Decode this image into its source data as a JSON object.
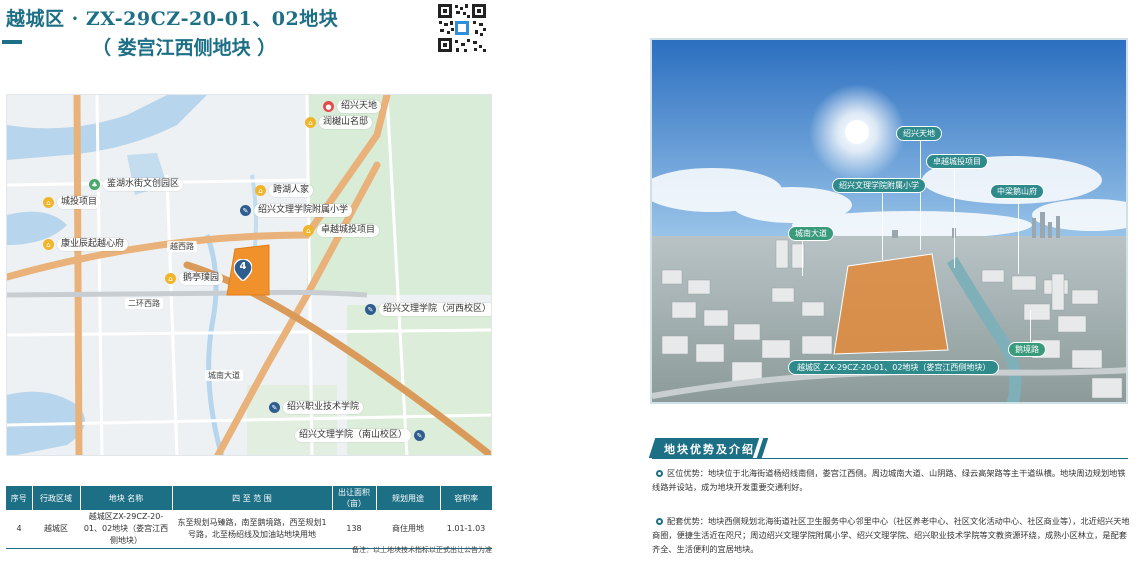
{
  "title": {
    "line1": "越城区 · ZX-29CZ-20-01、02地块",
    "line2": "（ 娄宫江西侧地块 ）"
  },
  "map": {
    "plot_number": "4",
    "roads": [
      "越西路",
      "二环西路",
      "城南大道"
    ],
    "pins": [
      {
        "label": "绍兴天地",
        "type": "red"
      },
      {
        "label": "润樾山名邸",
        "type": "yellow"
      },
      {
        "label": "鉴湖水街文创园区",
        "type": "green"
      },
      {
        "label": "城投项目",
        "type": "yellow"
      },
      {
        "label": "跨湖人家",
        "type": "yellow"
      },
      {
        "label": "绍兴文理学院附属小学",
        "type": "blue"
      },
      {
        "label": "卓越城投项目",
        "type": "yellow"
      },
      {
        "label": "康业辰起越心府",
        "type": "yellow"
      },
      {
        "label": "鹅亭璞园",
        "type": "yellow"
      },
      {
        "label": "绍兴文理学院（河西校区）",
        "type": "blue"
      },
      {
        "label": "绍兴职业技术学院",
        "type": "blue"
      },
      {
        "label": "绍兴文理学院（南山校区）",
        "type": "blue"
      }
    ]
  },
  "table": {
    "headers": [
      "序号",
      "行政区域",
      "地块 名称",
      "四 至 范 围",
      "出让面积（亩）",
      "规划用途",
      "容积率"
    ],
    "rows": [
      [
        "4",
        "越城区",
        "越城区ZX-29CZ-20-01、02地块（娄宫江西侧地块）",
        "东至规划马臻路，南至鹅境路，西至规划1号路，北至杨绍线及加油站地块用地",
        "138",
        "商住用地",
        "1.01-1.03"
      ]
    ],
    "note": "备注：以上地块技术指标以正式出让公告为准"
  },
  "aerial": {
    "callouts": {
      "shaoxing_tiandi": "绍兴天地",
      "zhuoyue": "卓越城投项目",
      "school": "绍兴文理学院附属小学",
      "zhongliang": "中梁鹅山府",
      "chengnan": "城南大道",
      "plot": "越城区 ZX-29CZ-20-01、02地块（娄宫江西侧地块）",
      "ejing": "鹅境路"
    }
  },
  "advantages": {
    "heading": "地块优势及介绍",
    "location_label": "区位优势：",
    "location_text": "地块位于北海街道杨绍线南侧，娄宫江西侧。周边城南大道、山阴路、绿云高架路等主干道纵横。地块周边规划地铁线路并设站，成为地块开发重要交通利好。",
    "facility_label": "配套优势：",
    "facility_text": "地块西侧规划北海街道社区卫生服务中心邻里中心（社区养老中心、社区文化活动中心、社区商业等），北近绍兴天地商圈，便捷生活近在咫尺；周边绍兴文理学院附属小学、绍兴文理学院、绍兴职业技术学院等文教资源环绕，成熟小区林立，是配套齐全、生活便利的宜居地块。"
  },
  "colors": {
    "accent": "#1d6f86",
    "plot": "#f0912b"
  }
}
